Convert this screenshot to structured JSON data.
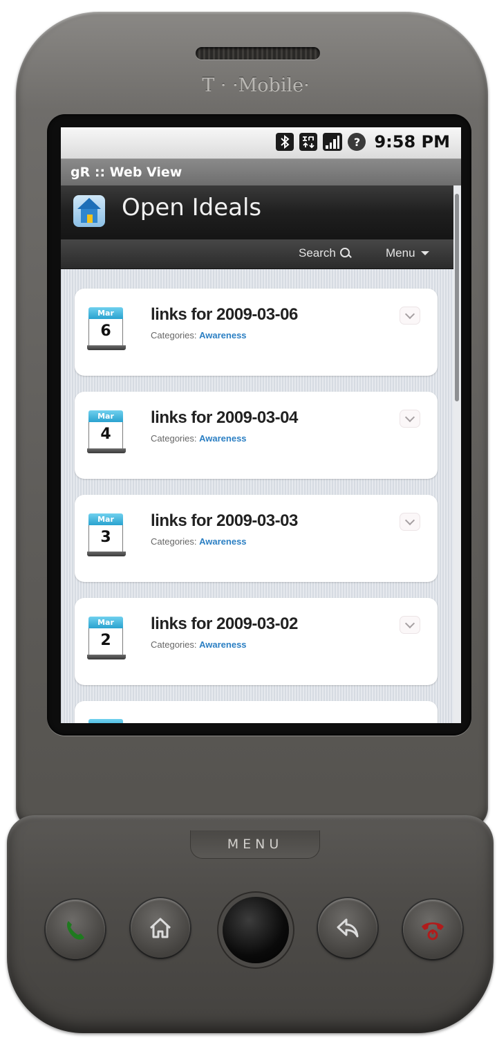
{
  "device": {
    "brand": "T · ·Mobile·",
    "menu_key_label": "MENU"
  },
  "status_bar": {
    "time": "9:58 PM",
    "icons": [
      "bluetooth-icon",
      "3g-icon",
      "signal-icon",
      "help-icon"
    ]
  },
  "window": {
    "title": "gR :: Web View"
  },
  "site": {
    "title": "Open Ideals",
    "nav": {
      "search_label": "Search",
      "menu_label": "Menu"
    }
  },
  "posts": [
    {
      "month": "Mar",
      "day": "6",
      "title": "links for 2009-03-06",
      "categories_label": "Categories:",
      "category": "Awareness"
    },
    {
      "month": "Mar",
      "day": "4",
      "title": "links for 2009-03-04",
      "categories_label": "Categories:",
      "category": "Awareness"
    },
    {
      "month": "Mar",
      "day": "3",
      "title": "links for 2009-03-03",
      "categories_label": "Categories:",
      "category": "Awareness"
    },
    {
      "month": "Mar",
      "day": "2",
      "title": "links for 2009-03-02",
      "categories_label": "Categories:",
      "category": "Awareness"
    }
  ],
  "colors": {
    "category_link": "#2b7fc3",
    "calendar_header": "#2aa2cf",
    "answer_key": "#1f7a1f",
    "end_key": "#b01c1c"
  }
}
